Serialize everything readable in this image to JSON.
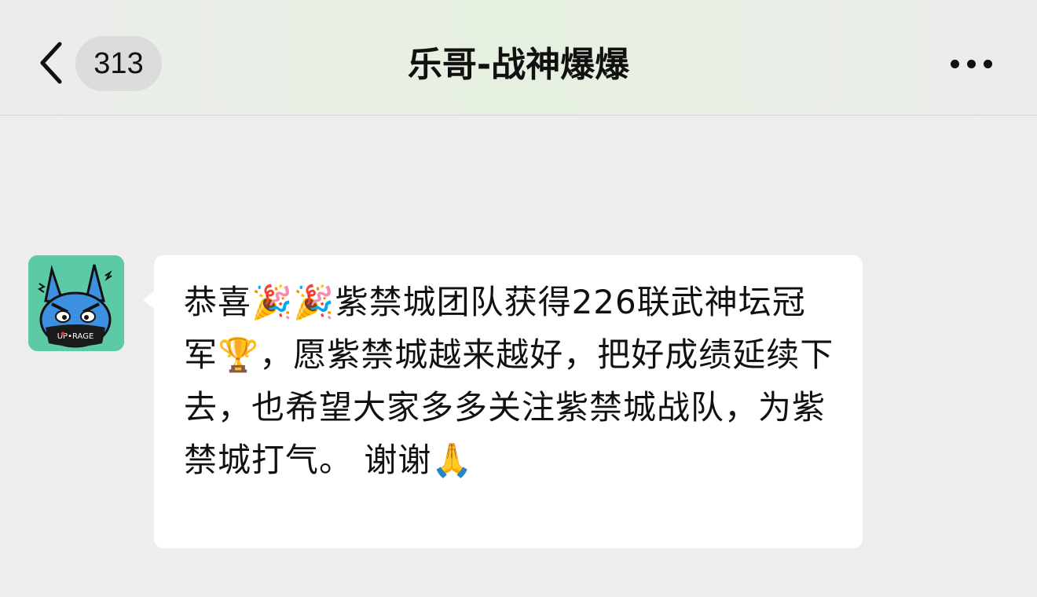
{
  "header": {
    "unread_count": "313",
    "title": "乐哥-战神爆爆"
  },
  "icons": {
    "back": "chevron-left-icon",
    "more": "more-horizontal-icon"
  },
  "message": {
    "sender_avatar": "blue-cartoon-rabbit-avatar",
    "text": "恭喜🎉🎉紫禁城团队获得226联武神坛冠军🏆，愿紫禁城越来越好，把好成绩延续下去，也希望大家多多关注紫禁城战队，为紫禁城打气。 谢谢🙏"
  },
  "colors": {
    "background": "#ededed",
    "bubble": "#ffffff",
    "avatar_bg": "#5cc9a7"
  }
}
